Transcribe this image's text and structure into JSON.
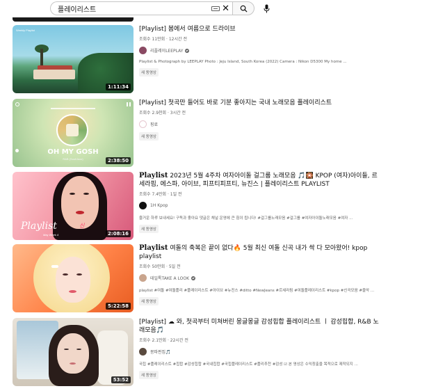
{
  "search": {
    "value": "플레이리스트",
    "placeholder": "검색"
  },
  "results": [
    {
      "title_prefix": "",
      "title": "[Playlist] 봄에서 여름으로 드라이브",
      "meta": "조회수 11만회 · 12시간 전",
      "channel": "리플레이LEEPLAY",
      "verified": true,
      "desc": "Playlist & Photograph by LEEPLAY Photo : Jeju Island, South Korea (2022) Camera : Nikon D5300 My home ...",
      "badge": "새 동영상",
      "duration": "1:11:34",
      "thumb_caption": "Weekly Playlist"
    },
    {
      "title_prefix": "",
      "title": "[Playlist] 첫곡만 들어도 바로 기분 좋아지는 국내 노래모음 플레이리스트",
      "meta": "조회수 2.9천회 · 3시간 전",
      "channel": "핑료",
      "verified": false,
      "desc": "",
      "badge": "새 동영상",
      "duration": "2:38:50",
      "thumb_big": "OH MY GOSH",
      "thumb_small": "R&B (Soul/Jazz)"
    },
    {
      "title_prefix": "Playlist",
      "title": " 2023년 5월 4주차 여자아이돌 걸그룹 노래모음 🎵🎇 KPOP (여자)아이들, 르세라핌, 에스파, 아이브, 피프티피프티, 뉴진스 | 플레이리스트 PLAYLIST",
      "meta": "조회수 7.4만회 · 1일 전",
      "channel": "1H Kpop",
      "verified": false,
      "desc": "즐거운 하루 보내세요! 구독과 좋아요 댓글은 채널 운영에 큰 힘이 됩니다! #걸그룹노래모음 #걸그룹 #여자아이돌노래모음 #여자 ...",
      "badge": "새 동영상",
      "duration": "2:08:16",
      "thumb_script": "Playlist",
      "thumb_script2": "신",
      "thumb_sub": "May Week 4"
    },
    {
      "title_prefix": "Playlist",
      "title": " 여돌의 축복은 끝이 없다🔥 5월 최신 여돌 신곡 내가 싹 다 모아왔어! kpop playlist",
      "meta": "조회수 50만회 · 5일 전",
      "channel": "테일톡TAKE A LOOK",
      "verified": true,
      "desc": "playlist #여돌 #여돌플리 #플레이리스트 #아이브 #뉴진스 #ditto #NewJeans #르세라핌 #여돌플레이리스트 #kpop #신곡모음 #을악 ...",
      "badge": "새 동영상",
      "duration": "5:22:58"
    },
    {
      "title_prefix": "",
      "title": "[Playlist] ☁ 와, 첫곡부터 미쳐버린 몽글몽글 감성힙합 플레이리스트 ㅣ 감성힙합, R&B 노래모음🎵",
      "meta": "조회수 2.1만회 · 22시간 전",
      "channel": "몽파펀집🎵",
      "verified": false,
      "desc": "국힙 #플레이리스트 #힙합 #감성힙합 #국내힙합 #국힙플레이리스트 #플리추천 #감성 ☑ 본 영상은 수익창출을 목적으로 제작되지 ...",
      "badge": "새 동영상",
      "duration": "53:52"
    }
  ]
}
